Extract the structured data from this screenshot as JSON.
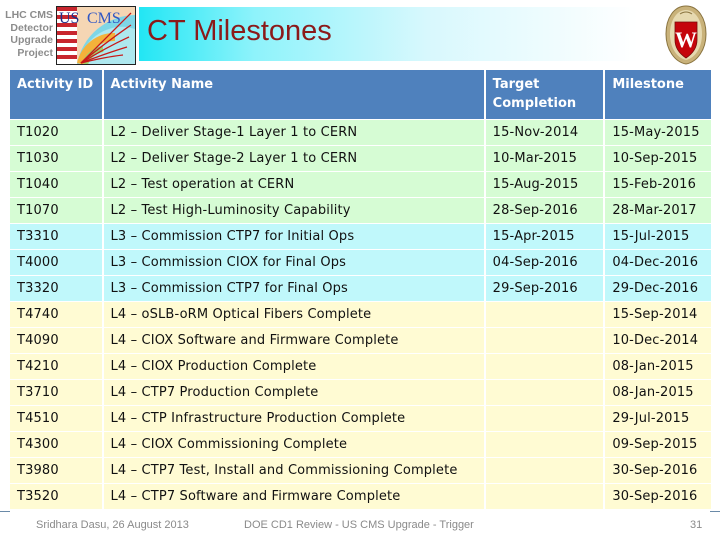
{
  "header": {
    "project_label_lines": [
      "LHC CMS",
      "Detector",
      "Upgrade",
      "Project"
    ],
    "logo_left": "US CMS logo",
    "title": "CT Milestones",
    "logo_right": "University of Wisconsin crest"
  },
  "colors": {
    "title_text": "#8b1a1a",
    "header_fill": "#4f81bd",
    "level_L2_fill": "#d6fcd4",
    "level_L3_fill": "#c0f8fb",
    "level_L4_fill": "#fffbd3"
  },
  "table": {
    "columns": [
      "Activity ID",
      "Activity Name",
      "Target Completion",
      "Milestone"
    ],
    "rows": [
      {
        "level": "L2",
        "id": "T1020",
        "name": "L2 – Deliver Stage-1 Layer 1 to CERN",
        "target": "15-Nov-2014",
        "milestone": "15-May-2015"
      },
      {
        "level": "L2",
        "id": "T1030",
        "name": "L2 – Deliver Stage-2 Layer 1 to CERN",
        "target": "10-Mar-2015",
        "milestone": "10-Sep-2015"
      },
      {
        "level": "L2",
        "id": "T1040",
        "name": "L2 – Test operation at CERN",
        "target": "15-Aug-2015",
        "milestone": "15-Feb-2016"
      },
      {
        "level": "L2",
        "id": "T1070",
        "name": "L2 – Test High-Luminosity Capability",
        "target": "28-Sep-2016",
        "milestone": "28-Mar-2017"
      },
      {
        "level": "L3",
        "id": "T3310",
        "name": "L3 – Commission CTP7 for Initial Ops",
        "target": "15-Apr-2015",
        "milestone": "15-Jul-2015"
      },
      {
        "level": "L3",
        "id": "T4000",
        "name": "L3 – Commission CIOX for Final Ops",
        "target": "04-Sep-2016",
        "milestone": "04-Dec-2016"
      },
      {
        "level": "L3",
        "id": "T3320",
        "name": "L3 – Commission CTP7 for Final Ops",
        "target": "29-Sep-2016",
        "milestone": "29-Dec-2016"
      },
      {
        "level": "L4",
        "id": "T4740",
        "name": "L4 – oSLB-oRM Optical Fibers Complete",
        "target": "",
        "milestone": "15-Sep-2014"
      },
      {
        "level": "L4",
        "id": "T4090",
        "name": "L4 – CIOX Software and Firmware Complete",
        "target": "",
        "milestone": "10-Dec-2014"
      },
      {
        "level": "L4",
        "id": "T4210",
        "name": "L4 – CIOX Production Complete",
        "target": "",
        "milestone": "08-Jan-2015"
      },
      {
        "level": "L4",
        "id": "T3710",
        "name": "L4 – CTP7 Production Complete",
        "target": "",
        "milestone": "08-Jan-2015"
      },
      {
        "level": "L4",
        "id": "T4510",
        "name": "L4 – CTP Infrastructure Production Complete",
        "target": "",
        "milestone": "29-Jul-2015"
      },
      {
        "level": "L4",
        "id": "T4300",
        "name": "L4 – CIOX Commissioning Complete",
        "target": "",
        "milestone": "09-Sep-2015"
      },
      {
        "level": "L4",
        "id": "T3980",
        "name": "L4 – CTP7 Test, Install and Commissioning Complete",
        "target": "",
        "milestone": "30-Sep-2016"
      },
      {
        "level": "L4",
        "id": "T3520",
        "name": "L4 – CTP7 Software and Firmware Complete",
        "target": "",
        "milestone": "30-Sep-2016"
      }
    ]
  },
  "footer": {
    "author_date": "Sridhara Dasu, 26 August 2013",
    "event": "DOE CD1 Review - US CMS Upgrade - Trigger",
    "page_number": "31"
  }
}
